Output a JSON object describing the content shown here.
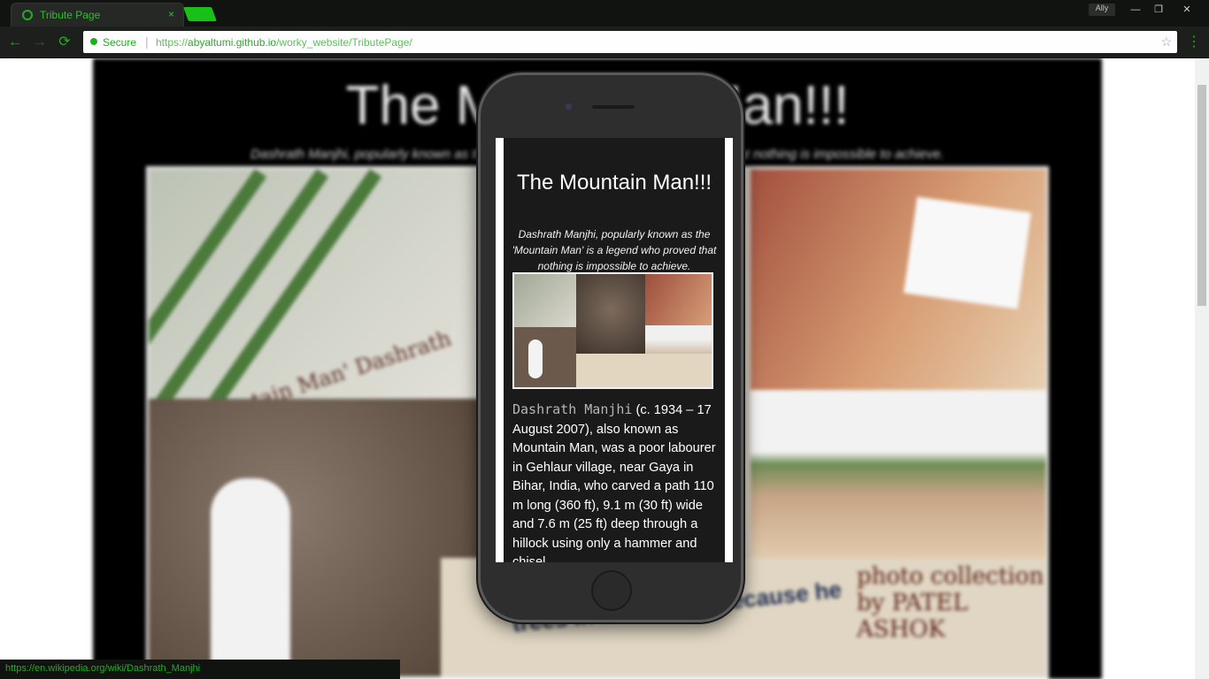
{
  "browser": {
    "tab_title": "Tribute Page",
    "tab_close": "×",
    "user": "Ally",
    "win_min": "—",
    "win_max": "❐",
    "win_close": "✕",
    "secure_label": "Secure",
    "url_prefix": "https://",
    "url_host": "abyaltumi.github.io",
    "url_path": "/worky_website/TributePage/",
    "nav_back": "←",
    "nav_forward": "→",
    "nav_reload": "⟳",
    "star": "☆",
    "menu": "⋮",
    "status_url": "https://en.wikipedia.org/wiki/Dashrath_Manjhi"
  },
  "background_page": {
    "title": "The Mountain Man!!!",
    "subtitle": "Dashrath Manjhi, popularly known as the 'Mountain Man' is a legend who proved that nothing is impossible to achieve.",
    "collage_caption_1": "'Mountain Man' Dashrath Manjhi",
    "collage_caption_2": "trees in the Valley, because he",
    "collage_note": "photo collection by PATEL ASHOK"
  },
  "phone": {
    "title": "The Mountain Man!!!",
    "subtitle": "Dashrath Manjhi, popularly known as the 'Mountain Man' is a legend who proved that nothing is impossible to achieve.",
    "body_name": "Dashrath Manjhi",
    "body_text": " (c. 1934 – 17 August 2007), also known as Mountain Man, was a poor labourer in Gehlaur village, near Gaya in Bihar, India, who carved a path 110 m long (360 ft), 9.1 m (30 ft) wide and 7.6 m (25 ft) deep through a hillock using only a hammer and chisel."
  },
  "icons": {
    "tab_favicon": "globe-icon",
    "lock": "lock-icon",
    "star": "star-icon",
    "menu": "menu-icon"
  },
  "colors": {
    "chrome_accent": "#1cb11c",
    "page_background": "#000000",
    "phone_body": "#2e2e2e"
  }
}
